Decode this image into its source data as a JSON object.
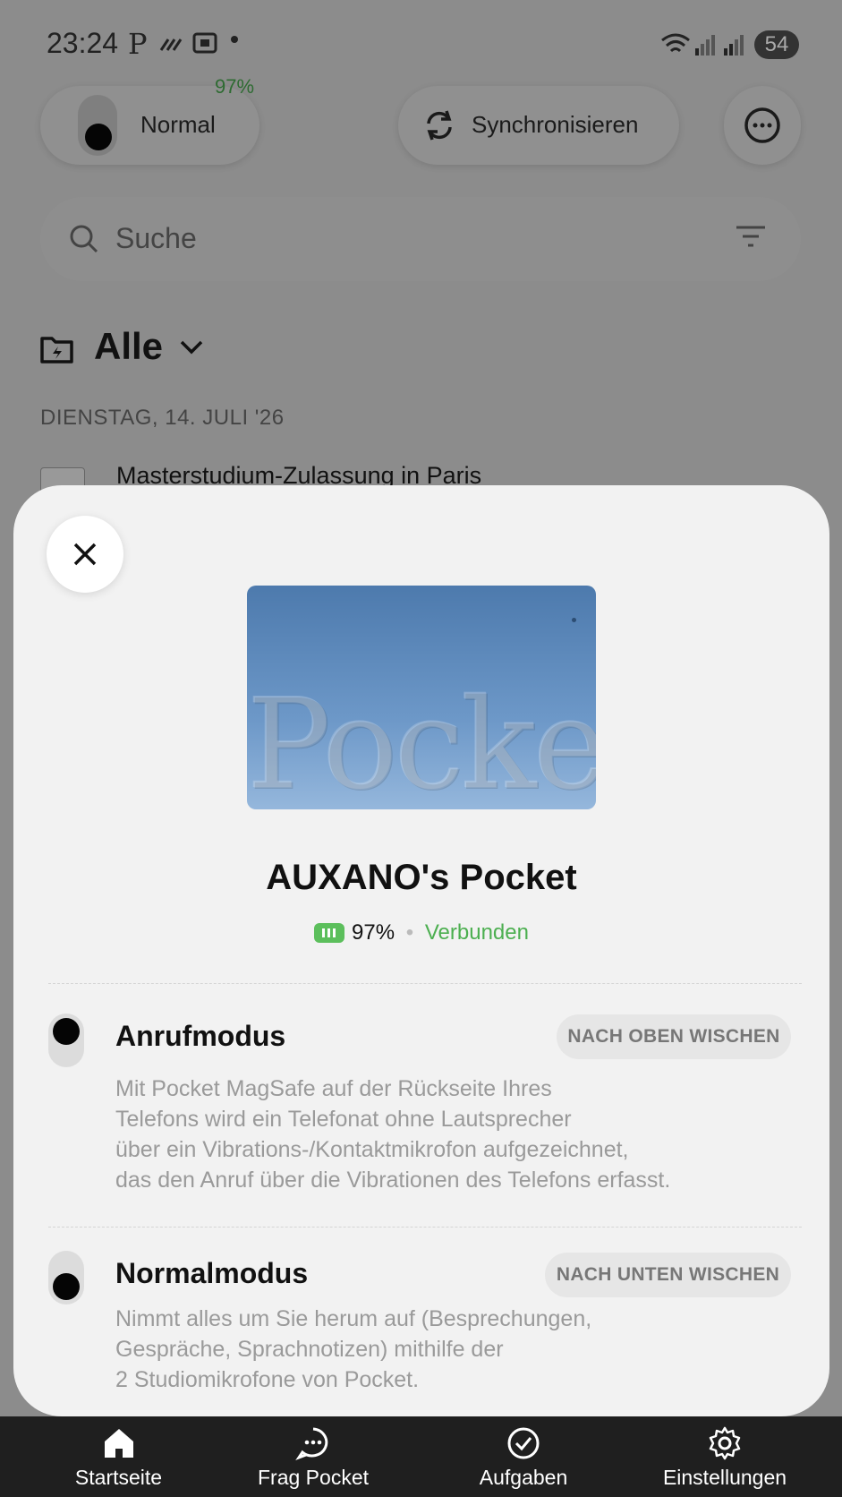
{
  "status_bar": {
    "time": "23:24",
    "p_indicator": "P",
    "battery": "54"
  },
  "top_bar": {
    "mode_label": "Normal",
    "device_battery": "97%",
    "sync_label": "Synchronisieren",
    "more_icon": "more-icon"
  },
  "search": {
    "placeholder": "Suche"
  },
  "filter": {
    "label": "Alle"
  },
  "list": {
    "date_header": "DIENSTAG, 14. JULI '26",
    "first_item": "Masterstudium-Zulassung in Paris"
  },
  "sheet": {
    "device_image_text": "Pocket",
    "device_name": "AUXANO's Pocket",
    "battery": "97%",
    "separator": "•",
    "connection": "Verbunden",
    "modes": [
      {
        "title": "Anrufmodus",
        "hint": "NACH OBEN WISCHEN",
        "description": "Mit Pocket MagSafe auf der Rückseite Ihres\nTelefons wird ein Telefonat ohne Lautsprecher\nüber ein Vibrations-/Kontaktmikrofon aufgezeichnet,\ndas den Anruf über die Vibrationen des Telefons erfasst."
      },
      {
        "title": "Normalmodus",
        "hint": "NACH UNTEN WISCHEN",
        "description": "Nimmt alles um Sie herum auf (Besprechungen,\nGespräche, Sprachnotizen) mithilfe der\n2 Studiomikrofone von Pocket."
      }
    ]
  },
  "tabs": [
    {
      "label": "Startseite",
      "icon": "home-icon"
    },
    {
      "label": "Frag Pocket",
      "icon": "chat-icon"
    },
    {
      "label": "Aufgaben",
      "icon": "check-circle-icon"
    },
    {
      "label": "Einstellungen",
      "icon": "gear-icon"
    }
  ],
  "colors": {
    "accent_green": "#4caf50",
    "device_blue": "#5a86b8",
    "tabbar": "#1f1f1f"
  }
}
